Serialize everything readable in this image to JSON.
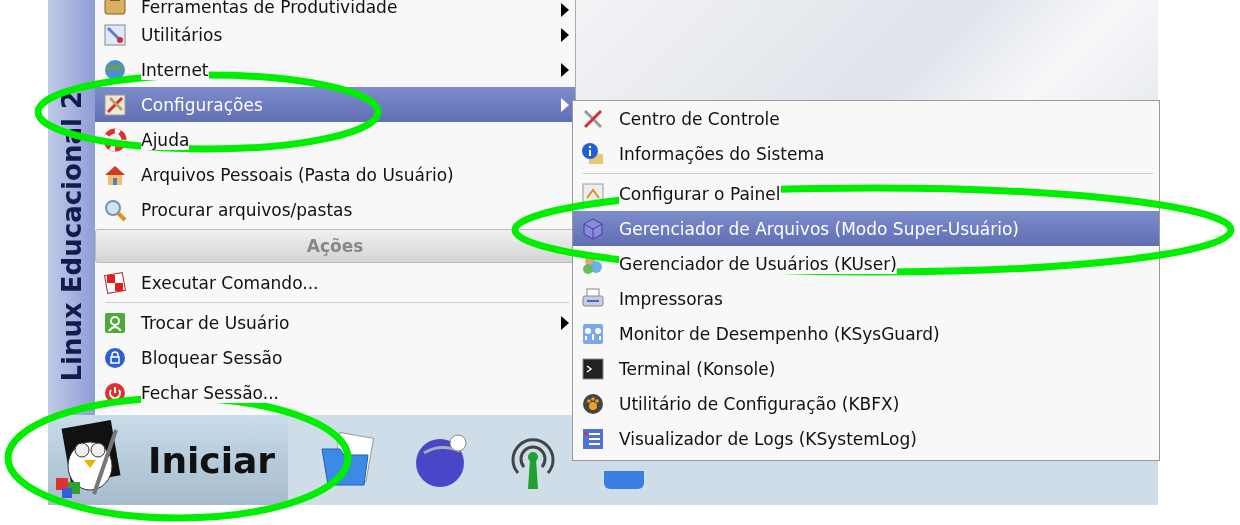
{
  "sidebar_banner": "Linux Educacional 2",
  "menu": {
    "items": [
      {
        "kind": "item",
        "label": "Ferramentas de Produtividade",
        "has_submenu": true,
        "selected": false
      },
      {
        "kind": "item",
        "label": "Utilitários",
        "has_submenu": true,
        "selected": false
      },
      {
        "kind": "item",
        "label": "Internet",
        "has_submenu": true,
        "selected": false
      },
      {
        "kind": "item",
        "label": "Configurações",
        "has_submenu": true,
        "selected": true
      },
      {
        "kind": "item",
        "label": "Ajuda",
        "has_submenu": false,
        "selected": false
      },
      {
        "kind": "item",
        "label": "Arquivos Pessoais (Pasta do Usuário)",
        "has_submenu": false,
        "selected": false
      },
      {
        "kind": "item",
        "label": "Procurar arquivos/pastas",
        "has_submenu": false,
        "selected": false
      },
      {
        "kind": "header",
        "label": "Ações"
      },
      {
        "kind": "item",
        "label": "Executar Comando...",
        "has_submenu": false,
        "selected": false
      },
      {
        "kind": "separator"
      },
      {
        "kind": "item",
        "label": "Trocar de Usuário",
        "has_submenu": true,
        "selected": false
      },
      {
        "kind": "item",
        "label": "Bloquear Sessão",
        "has_submenu": false,
        "selected": false
      },
      {
        "kind": "item",
        "label": "Fechar Sessão...",
        "has_submenu": false,
        "selected": false
      }
    ]
  },
  "submenu": {
    "items": [
      {
        "kind": "item",
        "label": "Centro de Controle",
        "selected": false
      },
      {
        "kind": "item",
        "label": "Informações do Sistema",
        "selected": false
      },
      {
        "kind": "separator"
      },
      {
        "kind": "item",
        "label": "Configurar o Painel",
        "selected": false
      },
      {
        "kind": "item",
        "label": "Gerenciador de Arquivos (Modo Super-Usuário)",
        "selected": true
      },
      {
        "kind": "item",
        "label": "Gerenciador de Usuários (KUser)",
        "selected": false
      },
      {
        "kind": "item",
        "label": "Impressoras",
        "selected": false
      },
      {
        "kind": "item",
        "label": "Monitor de Desempenho (KSysGuard)",
        "selected": false
      },
      {
        "kind": "item",
        "label": "Terminal (Konsole)",
        "selected": false
      },
      {
        "kind": "item",
        "label": "Utilitário de Configuração (KBFX)",
        "selected": false
      },
      {
        "kind": "item",
        "label": "Visualizador de Logs (KSystemLog)",
        "selected": false
      }
    ]
  },
  "taskbar": {
    "start_button": {
      "label": "Iniciar"
    }
  }
}
